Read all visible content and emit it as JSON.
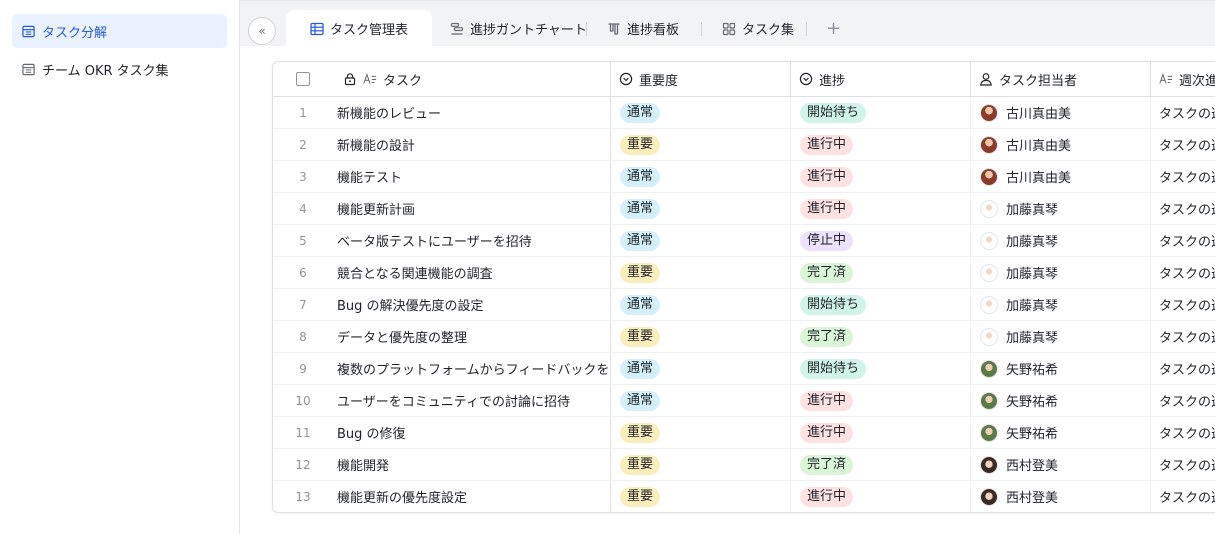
{
  "sidebar": {
    "items": [
      {
        "label": "タスク分解",
        "active": true
      },
      {
        "label": "チーム OKR タスク集",
        "active": false
      }
    ]
  },
  "tabs": [
    {
      "label": "タスク管理表",
      "icon": "grid-table-icon",
      "active": true
    },
    {
      "label": "進捗ガントチャート",
      "icon": "gantt-icon",
      "active": false
    },
    {
      "label": "進捗看板",
      "icon": "kanban-icon",
      "active": false
    },
    {
      "label": "タスク集",
      "icon": "gallery-icon",
      "active": false
    }
  ],
  "add_tab": "+",
  "collapse_symbol": "«",
  "columns": {
    "task": "タスク",
    "importance": "重要度",
    "progress": "進捗",
    "owner": "タスク担当者",
    "weekly": "週次進"
  },
  "colors": {
    "accent": "#245bdb",
    "normal_tag": "#d4f0fa",
    "important_tag": "#fbeebd",
    "waiting_tag": "#d2f4e8",
    "in_progress_tag": "#fde2e2",
    "stopped_tag": "#ece2fe",
    "done_tag": "#d9f5d6"
  },
  "rows": [
    {
      "idx": "1",
      "task": "新機能のレビュー",
      "importance": "通常",
      "progress": "開始待ち",
      "owner": "古川真由美",
      "weekly": "タスクの進"
    },
    {
      "idx": "2",
      "task": "新機能の設計",
      "importance": "重要",
      "progress": "進行中",
      "owner": "古川真由美",
      "weekly": "タスクの進"
    },
    {
      "idx": "3",
      "task": "機能テスト",
      "importance": "通常",
      "progress": "進行中",
      "owner": "古川真由美",
      "weekly": "タスクの進"
    },
    {
      "idx": "4",
      "task": "機能更新計画",
      "importance": "通常",
      "progress": "進行中",
      "owner": "加藤真琴",
      "weekly": "タスクの進"
    },
    {
      "idx": "5",
      "task": "ベータ版テストにユーザーを招待",
      "importance": "通常",
      "progress": "停止中",
      "owner": "加藤真琴",
      "weekly": "タスクの進"
    },
    {
      "idx": "6",
      "task": "競合となる関連機能の調査",
      "importance": "重要",
      "progress": "完了済",
      "owner": "加藤真琴",
      "weekly": "タスクの進"
    },
    {
      "idx": "7",
      "task": "Bug の解決優先度の設定",
      "importance": "通常",
      "progress": "開始待ち",
      "owner": "加藤真琴",
      "weekly": "タスクの進"
    },
    {
      "idx": "8",
      "task": "データと優先度の整理",
      "importance": "重要",
      "progress": "完了済",
      "owner": "加藤真琴",
      "weekly": "タスクの進"
    },
    {
      "idx": "9",
      "task": "複数のプラットフォームからフィードバックを収集",
      "importance": "通常",
      "progress": "開始待ち",
      "owner": "矢野祐希",
      "weekly": "タスクの進"
    },
    {
      "idx": "10",
      "task": "ユーザーをコミュニティでの討論に招待",
      "importance": "通常",
      "progress": "進行中",
      "owner": "矢野祐希",
      "weekly": "タスクの進"
    },
    {
      "idx": "11",
      "task": "Bug の修復",
      "importance": "重要",
      "progress": "進行中",
      "owner": "矢野祐希",
      "weekly": "タスクの進"
    },
    {
      "idx": "12",
      "task": "機能開発",
      "importance": "重要",
      "progress": "完了済",
      "owner": "西村登美",
      "weekly": "タスクの進"
    },
    {
      "idx": "13",
      "task": "機能更新の優先度設定",
      "importance": "重要",
      "progress": "進行中",
      "owner": "西村登美",
      "weekly": "タスクの進"
    }
  ]
}
